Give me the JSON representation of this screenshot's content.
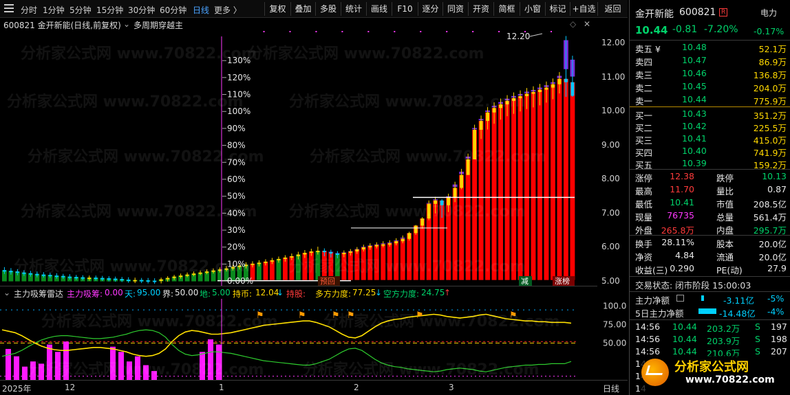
{
  "toolbar": {
    "periods": [
      "分时",
      "1分钟",
      "5分钟",
      "15分钟",
      "30分钟",
      "60分钟",
      "日线",
      "更多 〉"
    ],
    "active_period": "日线",
    "buttons": [
      "复权",
      "叠加",
      "多股",
      "统计",
      "画线",
      "F10",
      "逐分",
      "同资",
      "开资",
      "简框",
      "小窗",
      "标记",
      "+自选",
      "返回"
    ]
  },
  "chart_header": {
    "stock_title": "600821 金开新能(日线,前复权)",
    "indicator_title": "多周期穿越主"
  },
  "chart_data": {
    "type": "candlestick",
    "price_ticks": [
      "12.00",
      "11.00",
      "10.00",
      "9.00",
      "8.00",
      "7.00",
      "6.00",
      "5.00"
    ],
    "price_range": [
      4.85,
      12.35
    ],
    "pct_ticks": [
      "130%",
      "120%",
      "110%",
      "100%",
      "90%",
      "80%",
      "70%",
      "60%",
      "50%",
      "40%",
      "30%",
      "20%",
      "10%",
      "0.00%"
    ],
    "high_annotation": "12.20",
    "open": [
      5.31,
      5.29,
      5.27,
      5.24,
      5.22,
      5.2,
      5.18,
      5.17,
      5.15,
      5.14,
      5.12,
      5.11,
      5.1,
      5.09,
      5.09,
      5.08,
      5.07,
      5.06,
      5.05,
      5.03,
      5.02,
      5.02,
      5.01,
      5.0,
      4.99,
      5.04,
      5.08,
      5.12,
      5.15,
      5.18,
      5.21,
      5.24,
      5.27,
      5.3,
      5.33,
      5.36,
      5.4,
      5.44,
      5.47,
      5.5,
      5.53,
      5.56,
      5.6,
      5.64,
      5.68,
      5.72,
      5.77,
      5.82,
      5.86,
      5.88,
      5.84,
      5.8,
      5.78,
      5.82,
      5.86,
      5.92,
      5.98,
      6.02,
      6.05,
      6.07,
      6.1,
      6.16,
      6.23,
      6.4,
      6.62,
      6.83,
      7.26,
      7.36,
      7.22,
      7.44,
      7.73,
      8.11,
      8.57,
      9.44,
      9.7,
      9.95,
      10.08,
      10.19,
      10.29,
      10.37,
      10.43,
      10.5,
      10.55,
      10.62,
      10.68,
      10.78,
      10.94,
      10.84
    ],
    "high": [
      5.4,
      5.37,
      5.34,
      5.31,
      5.29,
      5.27,
      5.25,
      5.23,
      5.22,
      5.2,
      5.19,
      5.17,
      5.16,
      5.15,
      5.15,
      5.14,
      5.13,
      5.12,
      5.11,
      5.1,
      5.09,
      5.08,
      5.08,
      5.07,
      5.09,
      5.13,
      5.17,
      5.21,
      5.24,
      5.27,
      5.3,
      5.33,
      5.36,
      5.39,
      5.43,
      5.46,
      5.5,
      5.54,
      5.57,
      5.6,
      5.63,
      5.67,
      5.71,
      5.75,
      5.8,
      5.85,
      5.9,
      5.94,
      6.0,
      5.95,
      5.91,
      5.87,
      5.89,
      5.93,
      5.99,
      6.06,
      6.1,
      6.13,
      6.16,
      6.19,
      6.25,
      6.33,
      6.44,
      6.64,
      6.87,
      7.36,
      7.47,
      7.4,
      7.56,
      7.91,
      8.29,
      8.74,
      9.59,
      9.86,
      10.11,
      10.25,
      10.36,
      10.46,
      10.54,
      10.6,
      10.67,
      10.72,
      10.79,
      10.86,
      10.95,
      11.14,
      12.2,
      11.62
    ],
    "low": [
      5.2,
      5.18,
      5.16,
      5.14,
      5.12,
      5.1,
      5.09,
      5.08,
      5.06,
      5.05,
      5.03,
      5.02,
      5.01,
      5.0,
      5.0,
      4.99,
      4.98,
      4.97,
      4.96,
      4.94,
      4.93,
      4.93,
      4.92,
      4.91,
      4.92,
      4.97,
      5.02,
      5.06,
      5.1,
      5.13,
      5.16,
      5.19,
      5.21,
      5.24,
      5.27,
      5.3,
      5.33,
      5.36,
      5.39,
      5.42,
      5.45,
      5.49,
      5.53,
      5.56,
      5.6,
      5.63,
      5.67,
      5.73,
      5.77,
      5.72,
      5.68,
      5.66,
      5.69,
      5.74,
      5.79,
      5.86,
      5.91,
      5.95,
      5.98,
      6.0,
      6.04,
      6.1,
      6.18,
      6.35,
      6.53,
      6.78,
      6.98,
      6.85,
      7.02,
      7.31,
      7.69,
      8.12,
      8.91,
      9.17,
      9.45,
      9.62,
      9.74,
      9.84,
      9.91,
      9.98,
      10.05,
      10.1,
      10.16,
      10.24,
      10.34,
      10.51,
      10.41,
      10.41
    ],
    "close": [
      5.29,
      5.27,
      5.24,
      5.22,
      5.2,
      5.18,
      5.17,
      5.15,
      5.14,
      5.12,
      5.11,
      5.1,
      5.09,
      5.09,
      5.08,
      5.07,
      5.06,
      5.05,
      5.03,
      5.02,
      5.02,
      5.01,
      5.0,
      4.99,
      5.04,
      5.08,
      5.12,
      5.15,
      5.18,
      5.21,
      5.24,
      5.27,
      5.3,
      5.33,
      5.36,
      5.4,
      5.44,
      5.47,
      5.5,
      5.53,
      5.56,
      5.6,
      5.64,
      5.68,
      5.72,
      5.77,
      5.82,
      5.86,
      5.88,
      5.84,
      5.8,
      5.78,
      5.82,
      5.86,
      5.92,
      5.98,
      6.02,
      6.05,
      6.07,
      6.1,
      6.16,
      6.23,
      6.4,
      6.62,
      6.83,
      7.26,
      7.36,
      7.22,
      7.44,
      7.73,
      8.11,
      8.57,
      9.44,
      9.7,
      9.95,
      10.08,
      10.19,
      10.29,
      10.37,
      10.43,
      10.5,
      10.55,
      10.62,
      10.68,
      10.78,
      10.94,
      10.84,
      10.44
    ],
    "event_labels": [
      "预回",
      "减",
      "涨榜"
    ],
    "indicator": {
      "name": "主力吸筹雷达",
      "values": {
        "主力吸筹": "0.00",
        "天": "95.00",
        "界": "50.00",
        "地": "5.00",
        "持币": "12.04",
        "持股": "",
        "多方力度": "77.25",
        "空方力度": "24.75"
      },
      "ticks": [
        "100.0",
        "75.00",
        "50.00"
      ],
      "range": [
        0,
        110
      ],
      "ref_levels": [
        95,
        50,
        5
      ],
      "bull_strength": [
        68,
        66,
        64,
        60,
        55,
        50,
        46,
        43,
        41,
        40,
        40,
        41,
        42,
        43,
        44,
        44,
        43,
        42,
        40,
        38,
        35,
        33,
        32,
        33,
        36,
        42,
        52,
        60,
        65,
        67,
        66,
        64,
        62,
        62,
        63,
        64,
        66,
        68,
        70,
        72,
        74,
        75,
        76,
        77,
        78,
        79,
        80,
        80,
        78,
        75,
        72,
        67,
        62,
        58,
        57,
        60,
        66,
        72,
        77,
        80,
        82,
        83,
        85,
        86,
        87,
        88,
        89,
        88,
        86,
        85,
        84,
        85,
        86,
        88,
        89,
        87,
        85,
        83,
        82,
        81,
        80,
        80,
        79,
        79,
        78,
        78,
        78,
        77
      ],
      "bear_strength": [
        32,
        34,
        36,
        40,
        45,
        50,
        54,
        57,
        59,
        60,
        60,
        59,
        58,
        57,
        56,
        56,
        57,
        58,
        60,
        62,
        65,
        67,
        68,
        67,
        64,
        58,
        48,
        40,
        35,
        33,
        34,
        36,
        38,
        38,
        37,
        36,
        34,
        32,
        30,
        28,
        26,
        25,
        24,
        23,
        22,
        21,
        20,
        20,
        22,
        25,
        28,
        33,
        38,
        42,
        43,
        40,
        34,
        28,
        23,
        20,
        18,
        17,
        15,
        14,
        13,
        12,
        11,
        12,
        14,
        15,
        16,
        15,
        14,
        12,
        11,
        13,
        15,
        17,
        18,
        19,
        20,
        20,
        21,
        21,
        22,
        22,
        22,
        25
      ],
      "accumulation": [
        30,
        22,
        12,
        0,
        0,
        0,
        0,
        0,
        0,
        0,
        0,
        0,
        0,
        0,
        0,
        0,
        0,
        0,
        0,
        0,
        0,
        0,
        0,
        0,
        0,
        0,
        0,
        0,
        0,
        0,
        0,
        0,
        0,
        0,
        0,
        0,
        0,
        0,
        0,
        0,
        0,
        0,
        0,
        0,
        0,
        0,
        0,
        0,
        0,
        0,
        0,
        0,
        0,
        0,
        0,
        0,
        0,
        0,
        0,
        0,
        0,
        0,
        0,
        0,
        0,
        0,
        0,
        0,
        0,
        0,
        0,
        0,
        0,
        0,
        0,
        0,
        0,
        0,
        0,
        0,
        0,
        0,
        0,
        0,
        0,
        0,
        0,
        0
      ]
    },
    "date_labels": [
      "2025年",
      "12",
      "1",
      "2",
      "3"
    ],
    "period_label": "日线"
  },
  "quote": {
    "name": "金开新能",
    "code": "600821",
    "tag": "R",
    "sector": "电力",
    "price": "10.44",
    "change": "-0.81",
    "change_pct": "-7.20%",
    "sector_pct": "-0.17%",
    "asks": [
      {
        "label": "卖五",
        "price": "10.48",
        "vol": "52.1万"
      },
      {
        "label": "卖四",
        "price": "10.47",
        "vol": "86.9万"
      },
      {
        "label": "卖三",
        "price": "10.46",
        "vol": "136.8万"
      },
      {
        "label": "卖二",
        "price": "10.45",
        "vol": "204.0万"
      },
      {
        "label": "卖一",
        "price": "10.44",
        "vol": "775.9万"
      }
    ],
    "bids": [
      {
        "label": "买一",
        "price": "10.43",
        "vol": "351.2万"
      },
      {
        "label": "买二",
        "price": "10.42",
        "vol": "225.5万"
      },
      {
        "label": "买三",
        "price": "10.41",
        "vol": "415.0万"
      },
      {
        "label": "买四",
        "price": "10.40",
        "vol": "741.9万"
      },
      {
        "label": "买五",
        "price": "10.39",
        "vol": "159.2万"
      }
    ],
    "stats": [
      [
        "涨停",
        "12.38",
        "跌停",
        "10.13"
      ],
      [
        "最高",
        "11.70",
        "量比",
        "0.87"
      ],
      [
        "最低",
        "10.41",
        "市值",
        "208.5亿"
      ],
      [
        "现量",
        "76735",
        "总量",
        "561.4万"
      ],
      [
        "外盘",
        "265.8万",
        "内盘",
        "295.7万"
      ]
    ],
    "fundamentals": [
      [
        "换手",
        "28.11%",
        "股本",
        "20.0亿"
      ],
      [
        "净资",
        "4.84",
        "流通",
        "20.0亿"
      ],
      [
        "收益(三)",
        "0.290",
        "PE(动)",
        "27.9"
      ]
    ],
    "trade_status": "交易状态: 闭市阶段 15:00:03",
    "main_net": {
      "label": "主力净额",
      "value": "-3.11亿",
      "pct": "-5%"
    },
    "main_net_5d": {
      "label": "5日主力净额",
      "value": "-14.48亿",
      "pct": "-4%"
    },
    "ticks": [
      {
        "time": "14:56",
        "price": "10.44",
        "vol": "203.2万",
        "dir": "S",
        "num": "197"
      },
      {
        "time": "14:56",
        "price": "10.44",
        "vol": "203.9万",
        "dir": "S",
        "num": "198"
      },
      {
        "time": "14:56",
        "price": "10.44",
        "vol": "210.6万",
        "dir": "S",
        "num": "207"
      },
      {
        "time": "14",
        "price": "",
        "vol": "",
        "dir": "",
        "num": ""
      },
      {
        "time": "14",
        "price": "",
        "vol": "",
        "dir": "",
        "num": ""
      },
      {
        "time": "14",
        "price": "",
        "vol": "",
        "dir": "",
        "num": ""
      }
    ]
  },
  "watermark": "分析家公式网 www.70822.com",
  "logo": {
    "title": "分析家公式网",
    "url": "www.70822.com"
  }
}
